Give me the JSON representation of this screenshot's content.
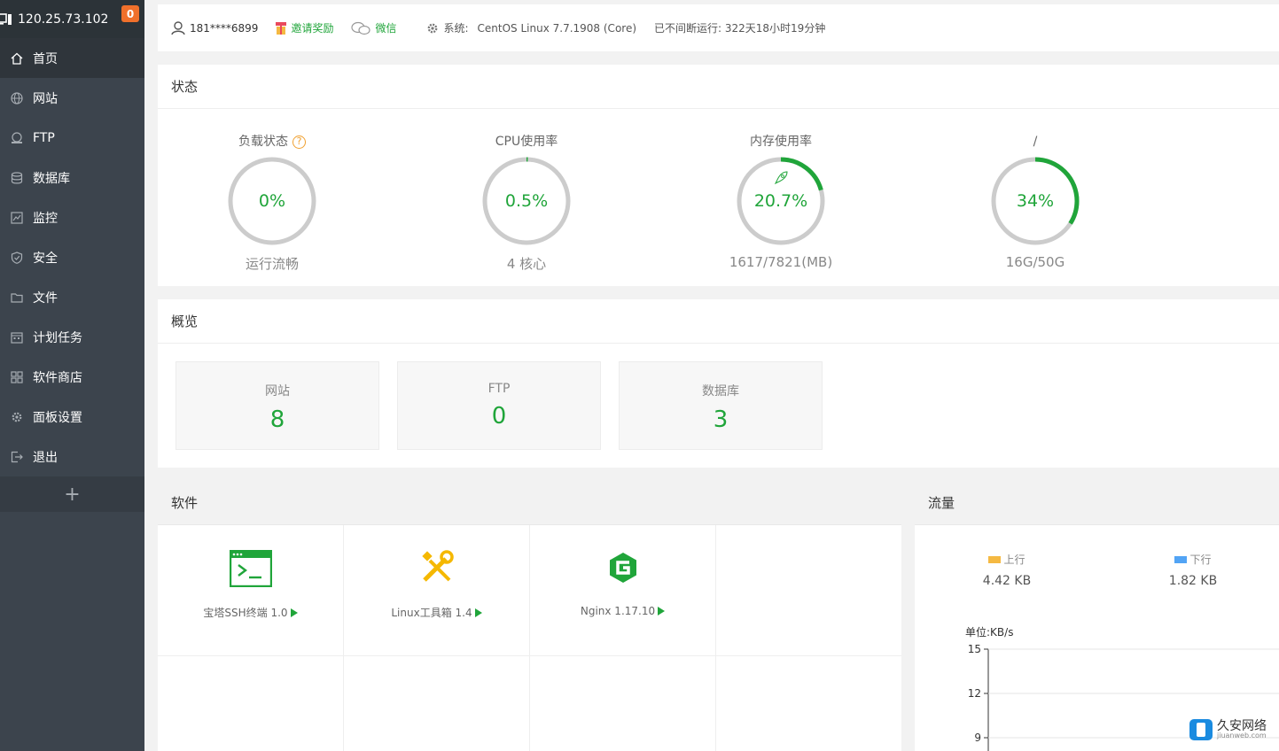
{
  "sidebar": {
    "server_ip": "120.25.73.102",
    "badge": "0",
    "items": [
      {
        "label": "首页",
        "icon": "home-icon"
      },
      {
        "label": "网站",
        "icon": "globe-icon"
      },
      {
        "label": "FTP",
        "icon": "ftp-icon"
      },
      {
        "label": "数据库",
        "icon": "database-icon"
      },
      {
        "label": "监控",
        "icon": "monitor-icon"
      },
      {
        "label": "安全",
        "icon": "shield-icon"
      },
      {
        "label": "文件",
        "icon": "folder-icon"
      },
      {
        "label": "计划任务",
        "icon": "calendar-icon"
      },
      {
        "label": "软件商店",
        "icon": "apps-icon"
      },
      {
        "label": "面板设置",
        "icon": "gear-icon"
      },
      {
        "label": "退出",
        "icon": "logout-icon"
      }
    ],
    "add_label": "+"
  },
  "topbar": {
    "user": "181****6899",
    "invite": "邀请奖励",
    "wechat": "微信",
    "system_label": "系统:",
    "system_value": "CentOS Linux 7.7.1908 (Core)",
    "uptime": "已不间断运行: 322天18小时19分钟"
  },
  "status": {
    "title": "状态",
    "gauges": [
      {
        "title": "负载状态",
        "value": "0%",
        "percent": 0,
        "sub": "运行流畅"
      },
      {
        "title": "CPU使用率",
        "value": "0.5%",
        "percent": 0.5,
        "sub": "4 核心"
      },
      {
        "title": "内存使用率",
        "value": "20.7%",
        "percent": 20.7,
        "sub": "1617/7821(MB)"
      },
      {
        "title": "/",
        "value": "34%",
        "percent": 34,
        "sub": "16G/50G"
      }
    ]
  },
  "overview": {
    "title": "概览",
    "boxes": [
      {
        "label": "网站",
        "value": "8"
      },
      {
        "label": "FTP",
        "value": "0"
      },
      {
        "label": "数据库",
        "value": "3"
      }
    ]
  },
  "software": {
    "title": "软件",
    "items": [
      {
        "name": "宝塔SSH终端 1.0",
        "icon": "terminal-icon"
      },
      {
        "name": "Linux工具箱 1.4",
        "icon": "tools-icon"
      },
      {
        "name": "Nginx 1.17.10",
        "icon": "nginx-icon"
      }
    ]
  },
  "traffic": {
    "title": "流量",
    "up_label": "上行",
    "up_value": "4.42 KB",
    "down_label": "下行",
    "down_value": "1.82 KB",
    "unit": "单位:KB/s",
    "colors": {
      "up": "#f5b942",
      "down": "#52a4f5"
    },
    "chart_data": {
      "type": "line",
      "ylabel": "单位:KB/s",
      "y_ticks": [
        15,
        12,
        9
      ],
      "series": []
    }
  },
  "watermark": {
    "cn": "久安网络",
    "en": "jiuanweb.com"
  }
}
